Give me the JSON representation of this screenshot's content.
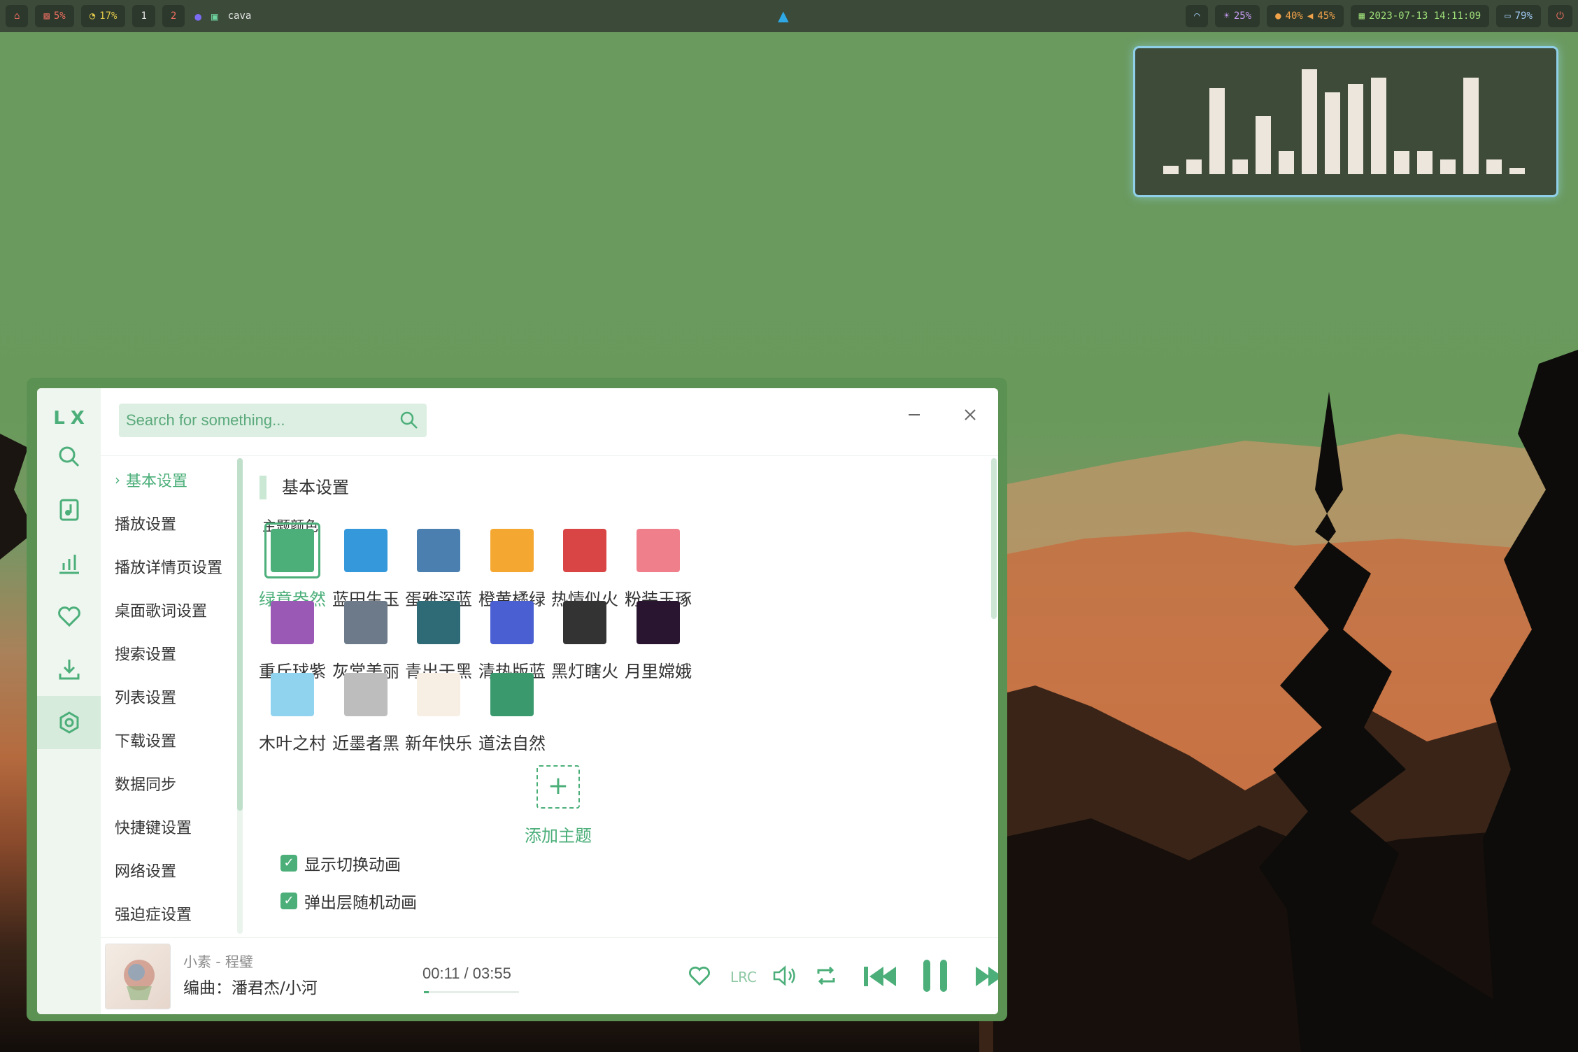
{
  "topbar": {
    "cpu": "5%",
    "mem": "17%",
    "workspaces": [
      "1",
      "2"
    ],
    "window_title": "cava",
    "brightness": "25%",
    "mic": "40%",
    "volume": "45%",
    "datetime": "2023-07-13 14:11:09",
    "battery": "79%"
  },
  "cava": {
    "levels": [
      0.08,
      0.14,
      0.82,
      0.14,
      0.55,
      0.22,
      1.0,
      0.78,
      0.86,
      0.92,
      0.22,
      0.22,
      0.14,
      0.92,
      0.14,
      0.06
    ]
  },
  "app": {
    "logo": "LX",
    "search_placeholder": "Search for something...",
    "nav": [
      {
        "label": "基本设置",
        "active": true
      },
      {
        "label": "播放设置"
      },
      {
        "label": "播放详情页设置"
      },
      {
        "label": "桌面歌词设置"
      },
      {
        "label": "搜索设置"
      },
      {
        "label": "列表设置"
      },
      {
        "label": "下载设置"
      },
      {
        "label": "数据同步"
      },
      {
        "label": "快捷键设置"
      },
      {
        "label": "网络设置"
      },
      {
        "label": "强迫症设置"
      }
    ],
    "section_title": "基本设置",
    "theme_heading": "主题颜色",
    "themes": [
      {
        "label": "绿意盎然",
        "color": "#4caf7a"
      },
      {
        "label": "蓝田生玉",
        "color": "#3498db"
      },
      {
        "label": "蛋雅深蓝",
        "color": "#4a7fb0"
      },
      {
        "label": "橙黄橘绿",
        "color": "#f4a832"
      },
      {
        "label": "热情似火",
        "color": "#d94545"
      },
      {
        "label": "粉装玉琢",
        "color": "#f07f8c"
      },
      {
        "label": "重斤球紫",
        "color": "#9b59b6"
      },
      {
        "label": "灰常美丽",
        "color": "#6c7a89"
      },
      {
        "label": "青出于黑",
        "color": "#2f6b77"
      },
      {
        "label": "清热版蓝",
        "color": "#4a5fd1"
      },
      {
        "label": "黑灯瞎火",
        "color": "#333333"
      },
      {
        "label": "月里嫦娥",
        "color": "#2a1530"
      },
      {
        "label": "木叶之村",
        "color": "#8fd3ee"
      },
      {
        "label": "近墨者黑",
        "color": "#bdbdbd"
      },
      {
        "label": "新年快乐",
        "color": "#f7efe4"
      },
      {
        "label": "道法自然",
        "color": "#3a9a6e"
      }
    ],
    "add_theme": "添加主题",
    "options": [
      {
        "label": "显示切换动画",
        "checked": true
      },
      {
        "label": "弹出层随机动画",
        "checked": true
      }
    ]
  },
  "player": {
    "title": "小素 - 程璧",
    "lyric": "编曲：潘君杰/小河",
    "time": "00:11 / 03:55",
    "progress": 0.05
  }
}
